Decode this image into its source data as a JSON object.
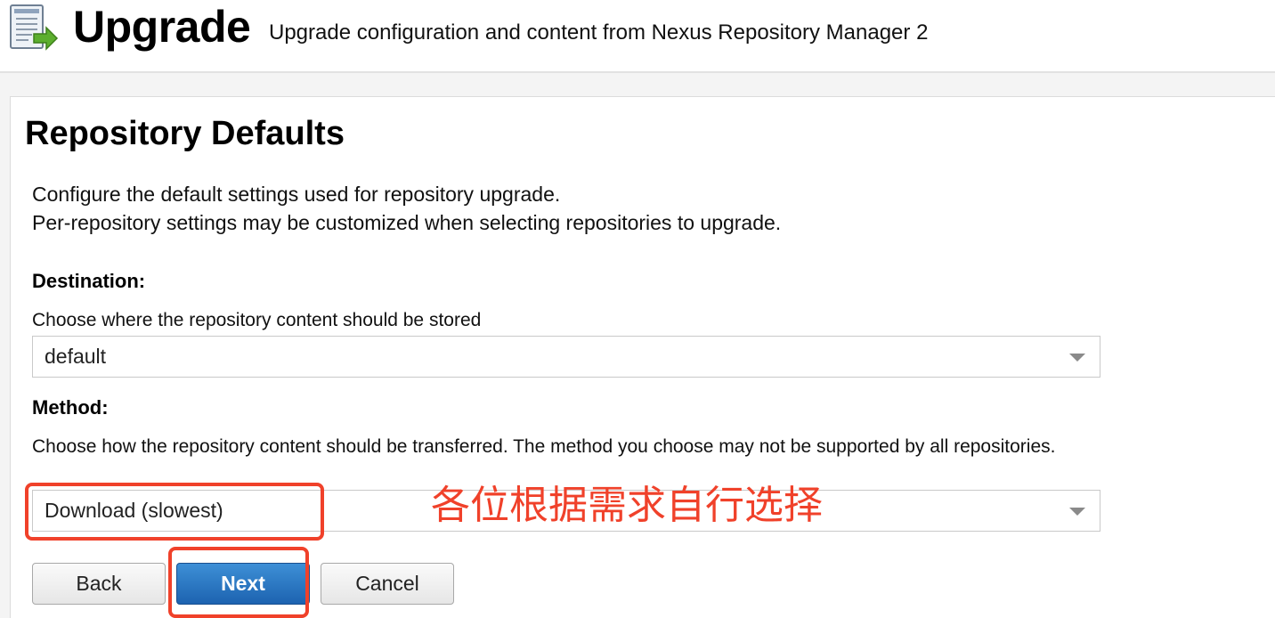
{
  "header": {
    "icon": "upgrade-document-arrow-icon",
    "title": "Upgrade",
    "subtitle": "Upgrade configuration and content from Nexus Repository Manager 2"
  },
  "section": {
    "title": "Repository Defaults",
    "description_line1": "Configure the default settings used for repository upgrade.",
    "description_line2": "Per-repository settings may be customized when selecting repositories to upgrade."
  },
  "destination": {
    "label": "Destination:",
    "help": "Choose where the repository content should be stored",
    "selected": "default"
  },
  "method": {
    "label": "Method:",
    "help": "Choose how the repository content should be transferred. The method you choose may not be supported by all repositories.",
    "selected": "Download (slowest)"
  },
  "buttons": {
    "back": "Back",
    "next": "Next",
    "cancel": "Cancel"
  },
  "annotation": {
    "text": "各位根据需求自行选择",
    "color": "#f0412a"
  },
  "colors": {
    "primary_button": "#1d63b0",
    "annotation": "#f0412a"
  }
}
